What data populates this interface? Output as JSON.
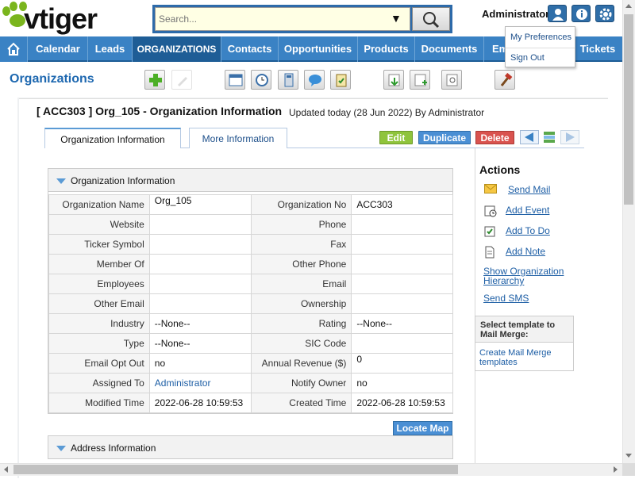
{
  "header": {
    "logo_text": "vtiger",
    "search_placeholder": "Search...",
    "admin_name": "Administrator"
  },
  "user_menu": {
    "items": [
      "My Preferences",
      "Sign Out"
    ]
  },
  "nav": {
    "items": [
      "Calendar",
      "Leads",
      "ORGANIZATIONS",
      "Contacts",
      "Opportunities",
      "Products",
      "Documents",
      "Em",
      "Tickets"
    ],
    "active": "ORGANIZATIONS"
  },
  "page": {
    "title": "Organizations"
  },
  "record": {
    "title": "[ ACC303 ] Org_105 - Organization Information",
    "updated": "Updated today (28 Jun 2022) By Administrator"
  },
  "tabs": [
    "Organization Information",
    "More Information"
  ],
  "buttons": {
    "edit": "Edit",
    "duplicate": "Duplicate",
    "delete": "Delete",
    "locate_map": "Locate Map"
  },
  "block1": {
    "title": "Organization Information",
    "rows": [
      {
        "l1": "Organization Name",
        "v1": "Org_105",
        "l2": "Organization No",
        "v2": "ACC303"
      },
      {
        "l1": "Website",
        "v1": "",
        "l2": "Phone",
        "v2": ""
      },
      {
        "l1": "Ticker Symbol",
        "v1": "",
        "l2": "Fax",
        "v2": ""
      },
      {
        "l1": "Member Of",
        "v1": "",
        "l2": "Other Phone",
        "v2": ""
      },
      {
        "l1": "Employees",
        "v1": "",
        "l2": "Email",
        "v2": ""
      },
      {
        "l1": "Other Email",
        "v1": "",
        "l2": "Ownership",
        "v2": ""
      },
      {
        "l1": "Industry",
        "v1": "--None--",
        "l2": "Rating",
        "v2": "--None--"
      },
      {
        "l1": "Type",
        "v1": "--None--",
        "l2": "SIC Code",
        "v2": ""
      },
      {
        "l1": "Email Opt Out",
        "v1": "no",
        "l2": "Annual Revenue ($)",
        "v2": "0"
      },
      {
        "l1": "Assigned To",
        "v1": "Administrator",
        "l2": "Notify Owner",
        "v2": "no"
      },
      {
        "l1": "Modified Time",
        "v1": "2022-06-28 10:59:53",
        "l2": "Created Time",
        "v2": "2022-06-28 10:59:53"
      }
    ]
  },
  "block2": {
    "title": "Address Information"
  },
  "actions": {
    "title": "Actions",
    "send_mail": "Send Mail",
    "add_event": "Add Event",
    "add_todo": "Add To Do",
    "add_note": "Add Note",
    "show_hierarchy": "Show Organization Hierarchy",
    "send_sms": "Send SMS",
    "mail_merge_title": "Select template to Mail Merge:",
    "mail_merge_link": "Create Mail Merge templates"
  },
  "colors": {
    "nav_bg": "#3a82c4",
    "nav_active": "#1e5d96",
    "link": "#1d5ea5",
    "edit": "#8fc43c",
    "duplicate": "#4a8fd4",
    "delete": "#d9534f"
  }
}
